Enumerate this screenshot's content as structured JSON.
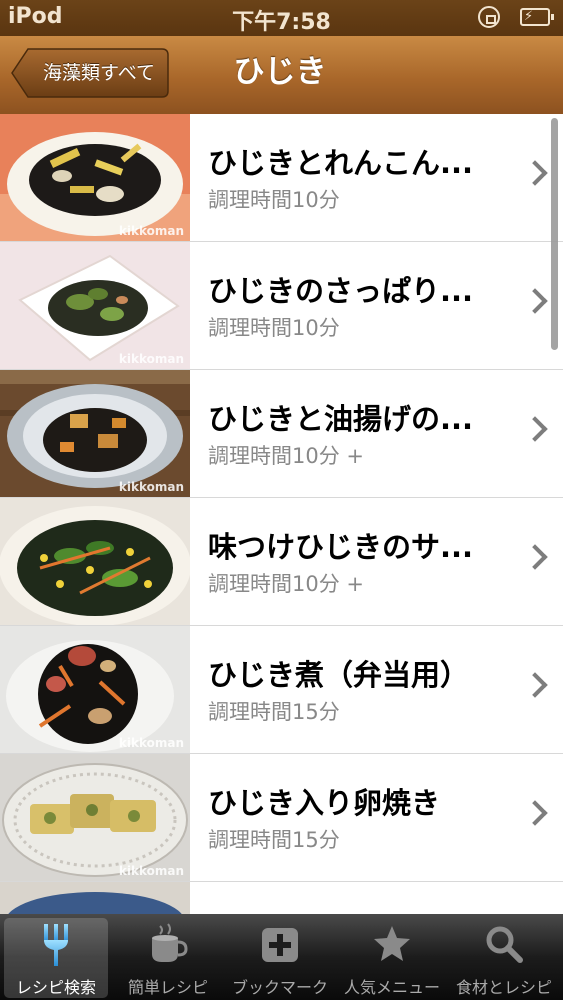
{
  "status_bar": {
    "carrier": "iPod",
    "time": "下午7:58"
  },
  "nav": {
    "back_label": "海藻類すべて",
    "title": "ひじき"
  },
  "recipes": [
    {
      "title": "ひじきとれんこん...",
      "subtitle": "調理時間10分",
      "watermark": "kikkoman"
    },
    {
      "title": "ひじきのさっぱり...",
      "subtitle": "調理時間10分",
      "watermark": "kikkoman"
    },
    {
      "title": "ひじきと油揚げの...",
      "subtitle": "調理時間10分 +",
      "watermark": "kikkoman"
    },
    {
      "title": "味つけひじきのサ...",
      "subtitle": "調理時間10分 +",
      "watermark": ""
    },
    {
      "title": "ひじき煮（弁当用）",
      "subtitle": "調理時間15分",
      "watermark": "kikkoman"
    },
    {
      "title": "ひじき入り卵焼き",
      "subtitle": "調理時間15分",
      "watermark": "kikkoman"
    }
  ],
  "tabs": [
    {
      "label": "レシピ検索",
      "icon": "fork-icon",
      "selected": true
    },
    {
      "label": "簡単レシピ",
      "icon": "cup-icon",
      "selected": false
    },
    {
      "label": "ブックマーク",
      "icon": "plus-icon",
      "selected": false
    },
    {
      "label": "人気メニュー",
      "icon": "star-icon",
      "selected": false
    },
    {
      "label": "食材とレシピ",
      "icon": "search-icon",
      "selected": false
    }
  ],
  "colors": {
    "nav_brown": "#a9672a",
    "status_brown": "#5a3510",
    "tab_dark": "#1c1c1c"
  }
}
